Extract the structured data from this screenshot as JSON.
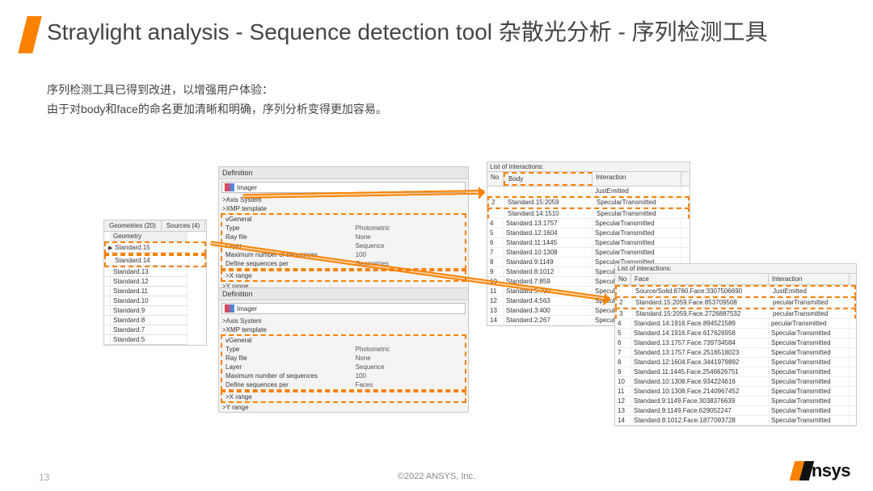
{
  "title": "Straylight analysis - Sequence detection tool 杂散光分析 - 序列检测工具",
  "desc_line1": "序列检测工具已得到改进，以增强用户体验：",
  "desc_line2": "由于对body和face的命名更加清晰和明确，序列分析变得更加容易。",
  "footer": "©2022 ANSYS, Inc.",
  "page_num": "13",
  "logo_text": "nsys",
  "geom_tabs": {
    "t1": "Geometries (20)",
    "t2": "Sources (4)",
    "col": "Geometry"
  },
  "geom_rows": [
    "Standard.15",
    "Standard.14",
    "Standard.13",
    "Standard.12",
    "Standard.11",
    "Standard.10",
    "Standard.9",
    "Standard.8",
    "Standard.7",
    "Standard.5"
  ],
  "def": {
    "title": "Definition",
    "name": "Imager",
    "group1": "Axis System",
    "group2": "XMP template",
    "group3": "General",
    "rows": {
      "type_k": "Type",
      "type_v": "Photometric",
      "ray_k": "Ray file",
      "ray_v": "None",
      "layer_k": "Layer",
      "layer_v": "Sequence",
      "max_k": "Maximum number of sequences",
      "max_v": "100",
      "defper_k": "Define sequences per",
      "defper_v_a": "Geometries",
      "defper_v_b": "Faces"
    },
    "xrange": "X range",
    "yrange": "Y range"
  },
  "body_list": {
    "title": "List of interactions:",
    "hdr": {
      "no": "No",
      "body": "Body",
      "inter": "Interaction"
    },
    "rows": [
      {
        "n": "",
        "b": "",
        "i": "JustEmitted"
      },
      {
        "n": "2",
        "b": "Standard.15:2059",
        "i": "SpecularTransmitted"
      },
      {
        "n": "",
        "b": "Standard.14:1510",
        "i": "SpecularTransmitted"
      },
      {
        "n": "4",
        "b": "Standard.13:1757",
        "i": "SpecularTransmitted"
      },
      {
        "n": "5",
        "b": "Standard.12:1604",
        "i": "SpecularTransmitted"
      },
      {
        "n": "6",
        "b": "Standard.11:1445",
        "i": "SpecularTransmitted"
      },
      {
        "n": "7",
        "b": "Standard.10:1308",
        "i": "SpecularTransmitted"
      },
      {
        "n": "8",
        "b": "Standard.9:1149",
        "i": "SpecularTransmitted"
      },
      {
        "n": "9",
        "b": "Standard.8:1012",
        "i": "SpecularTransmitted"
      },
      {
        "n": "10",
        "b": "Standard.7:859",
        "i": "SpecularTransmitted"
      },
      {
        "n": "11",
        "b": "Standard.5:700",
        "i": "SpecularTransmitted"
      },
      {
        "n": "12",
        "b": "Standard.4:563",
        "i": "SpecularTransmitted"
      },
      {
        "n": "13",
        "b": "Standard.3:400",
        "i": "SpecularTransmitted"
      },
      {
        "n": "14",
        "b": "Standard.2:267",
        "i": "SpecularTransmitted"
      }
    ]
  },
  "face_list": {
    "title": "List of interactions:",
    "hdr": {
      "no": "No",
      "face": "Face",
      "inter": "Interaction"
    },
    "rows": [
      {
        "n": "",
        "f": "Source/Solid:8760.Face:3307506690",
        "i": "JustEmitted"
      },
      {
        "n": "2",
        "f": "Standard.15:2059.Face.853709508",
        "i": "pecularTransmitted"
      },
      {
        "n": "3",
        "f": "Standard.15:2059.Face.2726887532",
        "i": "pecularTransmitted"
      },
      {
        "n": "4",
        "f": "Standard.14:1916.Face.894521589",
        "i": "pecularTransmitted"
      },
      {
        "n": "5",
        "f": "Standard.14:1916.Face.617626958",
        "i": "SpecularTransmitted"
      },
      {
        "n": "6",
        "f": "Standard.13:1757.Face.739734584",
        "i": "SpecularTransmitted"
      },
      {
        "n": "7",
        "f": "Standard.13:1757.Face.2516518023",
        "i": "SpecularTransmitted"
      },
      {
        "n": "8",
        "f": "Standard.12:1604.Face.3441979892",
        "i": "SpecularTransmitted"
      },
      {
        "n": "9",
        "f": "Standard.11:1445.Face.2546626751",
        "i": "SpecularTransmitted"
      },
      {
        "n": "10",
        "f": "Standard.10:1308.Face.934224616",
        "i": "SpecularTransmitted"
      },
      {
        "n": "11",
        "f": "Standard.10:1308.Face.2140967452",
        "i": "SpecularTransmitted"
      },
      {
        "n": "12",
        "f": "Standard.9:1149.Face.3038376639",
        "i": "SpecularTransmitted"
      },
      {
        "n": "13",
        "f": "Standard.9:1149.Face.629052247",
        "i": "SpecularTransmitted"
      },
      {
        "n": "14",
        "f": "Standard.8:1012.Face.1877093728",
        "i": "SpecularTransmitted"
      }
    ]
  }
}
